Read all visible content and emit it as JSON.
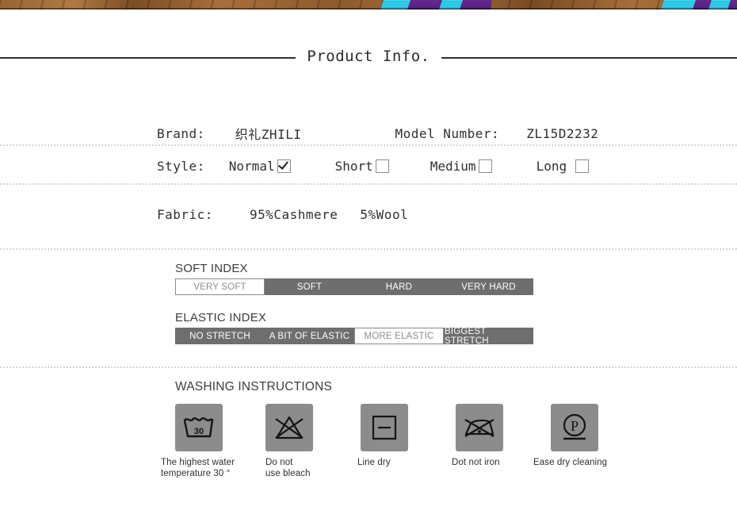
{
  "photo_strip": {
    "name": "product-photo-strip",
    "colors": {
      "wood": "#8d5a2c",
      "purple": "#5a2487",
      "cyan": "#34cfe9",
      "dark": "#565656"
    }
  },
  "section": {
    "title": "Product Info."
  },
  "specs": {
    "brand_label": "Brand:",
    "brand_value": "织礼ZHILI",
    "model_label": "Model Number:",
    "model_value": "ZL15D2232",
    "style_label": "Style:",
    "style_options": [
      {
        "label": "Normal",
        "checked": true
      },
      {
        "label": "Short",
        "checked": false
      },
      {
        "label": "Medium",
        "checked": false
      },
      {
        "label": "Long",
        "checked": false
      }
    ],
    "fabric_label": "Fabric:",
    "fabric_value_1": "95%Cashmere",
    "fabric_value_2": "5%Wool"
  },
  "soft_index": {
    "heading": "SOFT INDEX",
    "cells": [
      {
        "label": "VERY SOFT",
        "active": true
      },
      {
        "label": "SOFT",
        "active": false
      },
      {
        "label": "HARD",
        "active": false
      },
      {
        "label": "VERY HARD",
        "active": false
      }
    ]
  },
  "elastic_index": {
    "heading": "ELASTIC INDEX",
    "cells": [
      {
        "label": "NO STRETCH",
        "active": false
      },
      {
        "label": "A BIT OF ELASTIC",
        "active": false
      },
      {
        "label": "MORE ELASTIC",
        "active": true
      },
      {
        "label": "BIGGEST STRETCH",
        "active": false
      }
    ]
  },
  "washing": {
    "heading": "WASHING INSTRUCTIONS",
    "items": [
      {
        "icon": "wash-tub-30-icon",
        "caption_line1": "The highest water",
        "caption_line2": "temperature 30 °"
      },
      {
        "icon": "do-not-bleach-icon",
        "caption_line1": "Do not",
        "caption_line2": "use bleach"
      },
      {
        "icon": "line-dry-icon",
        "caption_line1": "Line dry",
        "caption_line2": ""
      },
      {
        "icon": "do-not-iron-icon",
        "caption_line1": "Dot not iron",
        "caption_line2": ""
      },
      {
        "icon": "dry-clean-p-icon",
        "caption_line1": "Ease dry cleaning",
        "caption_line2": ""
      }
    ],
    "tub_temperature": "30"
  },
  "colors": {
    "bar_gray": "#6e6e6e",
    "tile_gray": "#8c8c8c",
    "separator": "#d6d6d6",
    "title_rule": "#2f2f2f"
  }
}
